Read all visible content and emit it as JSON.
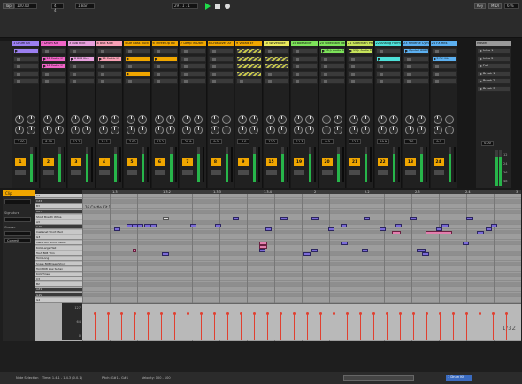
{
  "topbar": {
    "tap_label": "Tap",
    "tempo_value": "100.00",
    "signature_value": "4 / 4",
    "metro_value": "1 Bar",
    "position_value": "29 . 1 . 1",
    "key_label": "Key",
    "midi_label": "MIDI",
    "cpu_value": "6 %"
  },
  "tracks": [
    {
      "name": "1 Drum Kit",
      "color": "#9b7ff0",
      "slots": [
        {
          "type": "clip",
          "name": ""
        },
        {
          "type": "empty"
        },
        {
          "type": "empty"
        },
        {
          "type": "empty"
        },
        {
          "type": "empty"
        }
      ],
      "vol": "-7.00",
      "num": "1"
    },
    {
      "name": "2 Drum Kit",
      "color": "#f065c7",
      "slots": [
        {
          "type": "empty"
        },
        {
          "type": "clip",
          "name": "16 Castle K"
        },
        {
          "type": "clip",
          "name": "16 Castle K"
        },
        {
          "type": "empty"
        },
        {
          "type": "empty"
        }
      ],
      "vol": "-8.00",
      "num": "2"
    },
    {
      "name": "3 808 Kick",
      "color": "#e7a0dd",
      "slots": [
        {
          "type": "empty"
        },
        {
          "type": "clip",
          "name": "8 808 Kick"
        },
        {
          "type": "empty"
        },
        {
          "type": "empty"
        },
        {
          "type": "empty"
        }
      ],
      "vol": "-12.2",
      "num": "3"
    },
    {
      "name": "4 808 Kick",
      "color": "#f7a0b4",
      "slots": [
        {
          "type": "empty"
        },
        {
          "type": "clip",
          "name": "16 Castle K"
        },
        {
          "type": "empty"
        },
        {
          "type": "empty"
        },
        {
          "type": "empty"
        }
      ],
      "vol": "-14.1",
      "num": "4"
    },
    {
      "name": "5 De Bass Ruck",
      "color": "#f0a600",
      "slots": [
        {
          "type": "empty"
        },
        {
          "type": "clip",
          "name": ""
        },
        {
          "type": "empty"
        },
        {
          "type": "clip",
          "name": ""
        },
        {
          "type": "empty"
        }
      ],
      "vol": "-7.00",
      "num": "5"
    },
    {
      "name": "6 Three Op Bo",
      "color": "#f0a600",
      "slots": [
        {
          "type": "empty"
        },
        {
          "type": "clip",
          "name": ""
        },
        {
          "type": "empty"
        },
        {
          "type": "empty"
        },
        {
          "type": "empty"
        }
      ],
      "vol": "-13.2",
      "num": "6"
    },
    {
      "name": "7 Deep In Dark",
      "color": "#f0a600",
      "slots": [
        {
          "type": "empty"
        },
        {
          "type": "empty"
        },
        {
          "type": "empty"
        },
        {
          "type": "empty"
        },
        {
          "type": "empty"
        }
      ],
      "vol": "-20.9",
      "num": "7"
    },
    {
      "name": "8 Crossover Ar",
      "color": "#f0a600",
      "slots": [
        {
          "type": "empty"
        },
        {
          "type": "empty"
        },
        {
          "type": "empty"
        },
        {
          "type": "empty"
        },
        {
          "type": "empty"
        }
      ],
      "vol": "-9.0",
      "num": "8"
    },
    {
      "name": "9 Vocals Er",
      "color": "#f0a600",
      "slots": [
        {
          "type": "hatch"
        },
        {
          "type": "hatch"
        },
        {
          "type": "hatch"
        },
        {
          "type": "hatch"
        },
        {
          "type": "empty"
        }
      ],
      "vol": "-6.0",
      "num": "9"
    },
    {
      "name": "10 Wavetable",
      "color": "#e9e95c",
      "slots": [
        {
          "type": "empty"
        },
        {
          "type": "hatch"
        },
        {
          "type": "hatch"
        },
        {
          "type": "empty"
        },
        {
          "type": "empty"
        }
      ],
      "vol": "-12.2",
      "num": "15"
    },
    {
      "name": "15 Bowstiller",
      "color": "#7de35a",
      "slots": [
        {
          "type": "empty"
        },
        {
          "type": "empty"
        },
        {
          "type": "empty"
        },
        {
          "type": "empty"
        },
        {
          "type": "empty"
        }
      ],
      "vol": "-11.3",
      "num": "19"
    },
    {
      "name": "20 Sidechain Pad",
      "color": "#7de35a",
      "slots": [
        {
          "type": "clip",
          "name": "18-Jr Audio 003"
        },
        {
          "type": "empty"
        },
        {
          "type": "empty"
        },
        {
          "type": "empty"
        },
        {
          "type": "empty"
        }
      ],
      "vol": "-9.0",
      "num": "20"
    },
    {
      "name": "21 Sidechain Pad",
      "color": "#c6e35a",
      "slots": [
        {
          "type": "clip",
          "name": "19-Jr Audio 003"
        },
        {
          "type": "empty"
        },
        {
          "type": "empty"
        },
        {
          "type": "empty"
        },
        {
          "type": "empty"
        }
      ],
      "vol": "-12.2",
      "num": "21"
    },
    {
      "name": "22 Analog Harm",
      "color": "#4ee0d8",
      "slots": [
        {
          "type": "empty"
        },
        {
          "type": "clip",
          "name": ""
        },
        {
          "type": "empty"
        },
        {
          "type": "empty"
        },
        {
          "type": "empty"
        }
      ],
      "vol": "-19.9",
      "num": "22"
    },
    {
      "name": "23 Reverse Cymbal",
      "color": "#5cb0f0",
      "slots": [
        {
          "type": "clip",
          "name": "Cymbal 808 Rise"
        },
        {
          "type": "empty"
        },
        {
          "type": "empty"
        },
        {
          "type": "empty"
        },
        {
          "type": "empty"
        }
      ],
      "vol": "-7.0",
      "num": "13"
    },
    {
      "name": "24 FX Hits",
      "color": "#5cb0f0",
      "slots": [
        {
          "type": "empty"
        },
        {
          "type": "clip",
          "name": "5 FX Hits"
        },
        {
          "type": "empty"
        },
        {
          "type": "empty"
        },
        {
          "type": "empty"
        }
      ],
      "vol": "-9.0",
      "num": "24"
    }
  ],
  "master": {
    "name": "Master",
    "scenes": [
      "Intro 1",
      "Intro 2",
      "Full",
      "Break 1",
      "Break 2",
      "Break 3"
    ],
    "vol": "0.00",
    "cue_labels": [
      "12",
      "24",
      "36",
      "48"
    ]
  },
  "detail": {
    "clip_title": "Clip",
    "clip_name": "16 Castle Kit 1",
    "signature_label": "Signature",
    "groove_label": "Groove",
    "commit_label": "Commit",
    "ruler_marks": [
      "1.3",
      "1.3.2",
      "1.3.3",
      "1.3.4",
      "2",
      "2.2",
      "2.3",
      "2.4",
      "3"
    ],
    "rows": [
      "C4",
      "C#4",
      "B3",
      "A#3",
      "Short Breath Whoa",
      "A3",
      "G#3",
      "Castanet Short Med",
      "G3",
      "Metal Riff Short Castle",
      "Kick Large Hall",
      "Tosh 808 Thin",
      "Tom Long",
      "Snare 808 Deep Short",
      "Tom 808 Low Sultan",
      "Kick Tinsel",
      "C3",
      "B2",
      "A#2",
      "G#2",
      "G2"
    ],
    "vel_scale": [
      "127",
      "64",
      "0"
    ],
    "grid_label": "1/32"
  },
  "status": {
    "left": "Note Selection",
    "time": "Time: 1.4.1 - 1.4.3 (0.0.1)",
    "pitch": "Pitch: G#1 - G#1",
    "velocity": "Velocity: 100 - 100",
    "right": "1 Drum Kit"
  }
}
